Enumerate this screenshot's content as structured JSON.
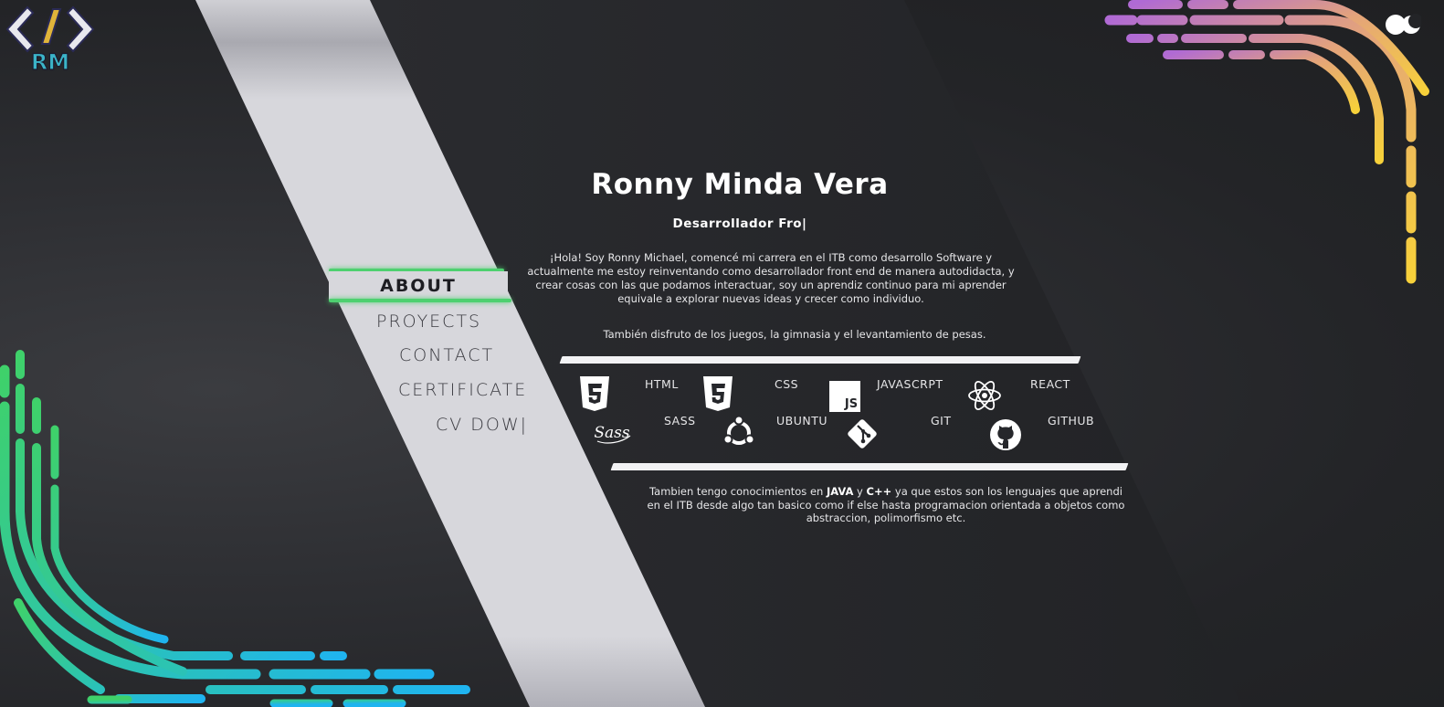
{
  "logo": {
    "text": "RM"
  },
  "nav": {
    "items": [
      {
        "label": "ABOUT",
        "active": true
      },
      {
        "label": "PROYECTS"
      },
      {
        "label": "CONTACT"
      },
      {
        "label": "CERTIFICATE"
      },
      {
        "label": "CV DOW|"
      }
    ]
  },
  "profile": {
    "name": "Ronny Minda Vera",
    "role": "Desarrollador Fro|",
    "bio": "¡Hola! Soy Ronny Michael, comencé mi carrera en el ITB como desarrollo Software y actualmente me estoy reinventando como desarrollador front end de manera autodidacta, y crear cosas con las que podamos interactuar, soy un aprendiz continuo para mi aprender equivale a explorar nuevas ideas y crecer como individuo.",
    "hobbies": "También disfruto de los juegos, la gimnasia y el levantamiento de pesas."
  },
  "skills": {
    "html": "HTML",
    "css": "CSS",
    "javascript": "JAVASCRPT",
    "javascript_badge": "JS",
    "react": "REACT",
    "sass": "SASS",
    "sass_logo": "Sass",
    "ubuntu": "UBUNTU",
    "git": "GIT",
    "github": "GITHUB"
  },
  "extra": {
    "part1": "Tambien tengo conocimientos en ",
    "java": "JAVA",
    "and": " y ",
    "cpp": "C++",
    "part2": " ya que estos son los lenguajes que aprendi",
    "part3": "en el ITB desde algo tan basico como if else hasta programacion orientada a objetos como abstraccion, polimorfismo etc."
  },
  "colors": {
    "accent_green": "#4ed070",
    "panel_light": "#d7d7dc",
    "panel_dark": "#26272b",
    "wave_purple": "#b06ad4",
    "wave_yellow": "#f7d13a",
    "wave_green": "#3fd16a",
    "wave_blue": "#1fb4f0"
  }
}
